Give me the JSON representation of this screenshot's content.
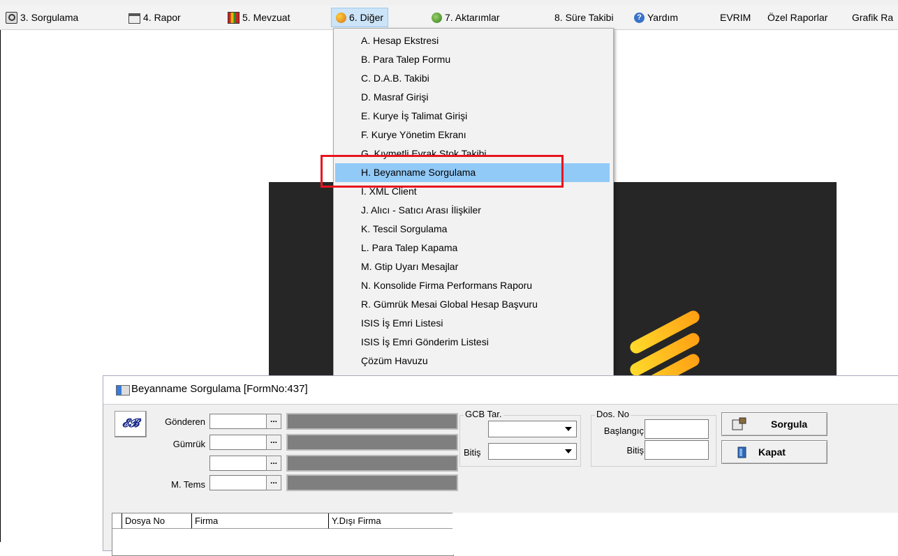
{
  "menubar": {
    "items": [
      {
        "label": "3.  Sorgulama",
        "icon": "magnifier-doc-icon"
      },
      {
        "label": "4.  Rapor",
        "icon": "printer-icon"
      },
      {
        "label": "5.  Mevzuat",
        "icon": "books-icon"
      },
      {
        "label": "6.  Diğer",
        "icon": "other-tools-icon"
      },
      {
        "label": "7.  Aktarımlar",
        "icon": "transfer-icon"
      },
      {
        "label": "8. Süre Takibi",
        "icon": ""
      },
      {
        "label": "Yardım",
        "icon": "help-icon"
      },
      {
        "label": "EVRIM",
        "icon": ""
      },
      {
        "label": "Özel Raporlar",
        "icon": ""
      },
      {
        "label": "Grafik Ra",
        "icon": ""
      }
    ],
    "active_index": 3
  },
  "dropdown": {
    "items": [
      "A.  Hesap Ekstresi",
      "B.  Para Talep Formu",
      "C.  D.A.B. Takibi",
      "D.  Masraf Girişi",
      "E.  Kurye İş Talimat Girişi",
      "F.  Kurye Yönetim Ekranı",
      "G.  Kıymetli Evrak Stok Takibi",
      "H.  Beyanname Sorgulama",
      "I.  XML Client",
      "J.  Alıcı - Satıcı Arası İlişkiler",
      "K.  Tescil Sorgulama",
      "L. Para Talep Kapama",
      "M. Gtip Uyarı Mesajlar",
      "N. Konsolide Firma Performans Raporu",
      "R. Gümrük Mesai Global Hesap Başvuru",
      "ISIS İş Emri Listesi",
      "ISIS İş Emri Gönderim Listesi",
      "Çözüm Havuzu"
    ],
    "selected_index": 7,
    "highlight_color": "#e8141e"
  },
  "form": {
    "title": "Beyanname Sorgulama [FormNo:437]",
    "logo_text": "𝓔𝓑",
    "fields": {
      "gonderen": "Gönderen",
      "gumruk": "Gümrük",
      "mtems": "M. Tems",
      "dots": "..."
    },
    "gcb": {
      "label": "GCB Tar.",
      "bitis": "Bitiş"
    },
    "dosno": {
      "label": "Dos. No",
      "baslangic": "Başlangıç",
      "bitis": "Bitiş"
    },
    "buttons": {
      "sorgula": "Sorgula",
      "kapat": "Kapat"
    },
    "grid": {
      "columns": [
        "Dosya No",
        "Firma",
        "Y.Dışı Firma"
      ]
    }
  }
}
